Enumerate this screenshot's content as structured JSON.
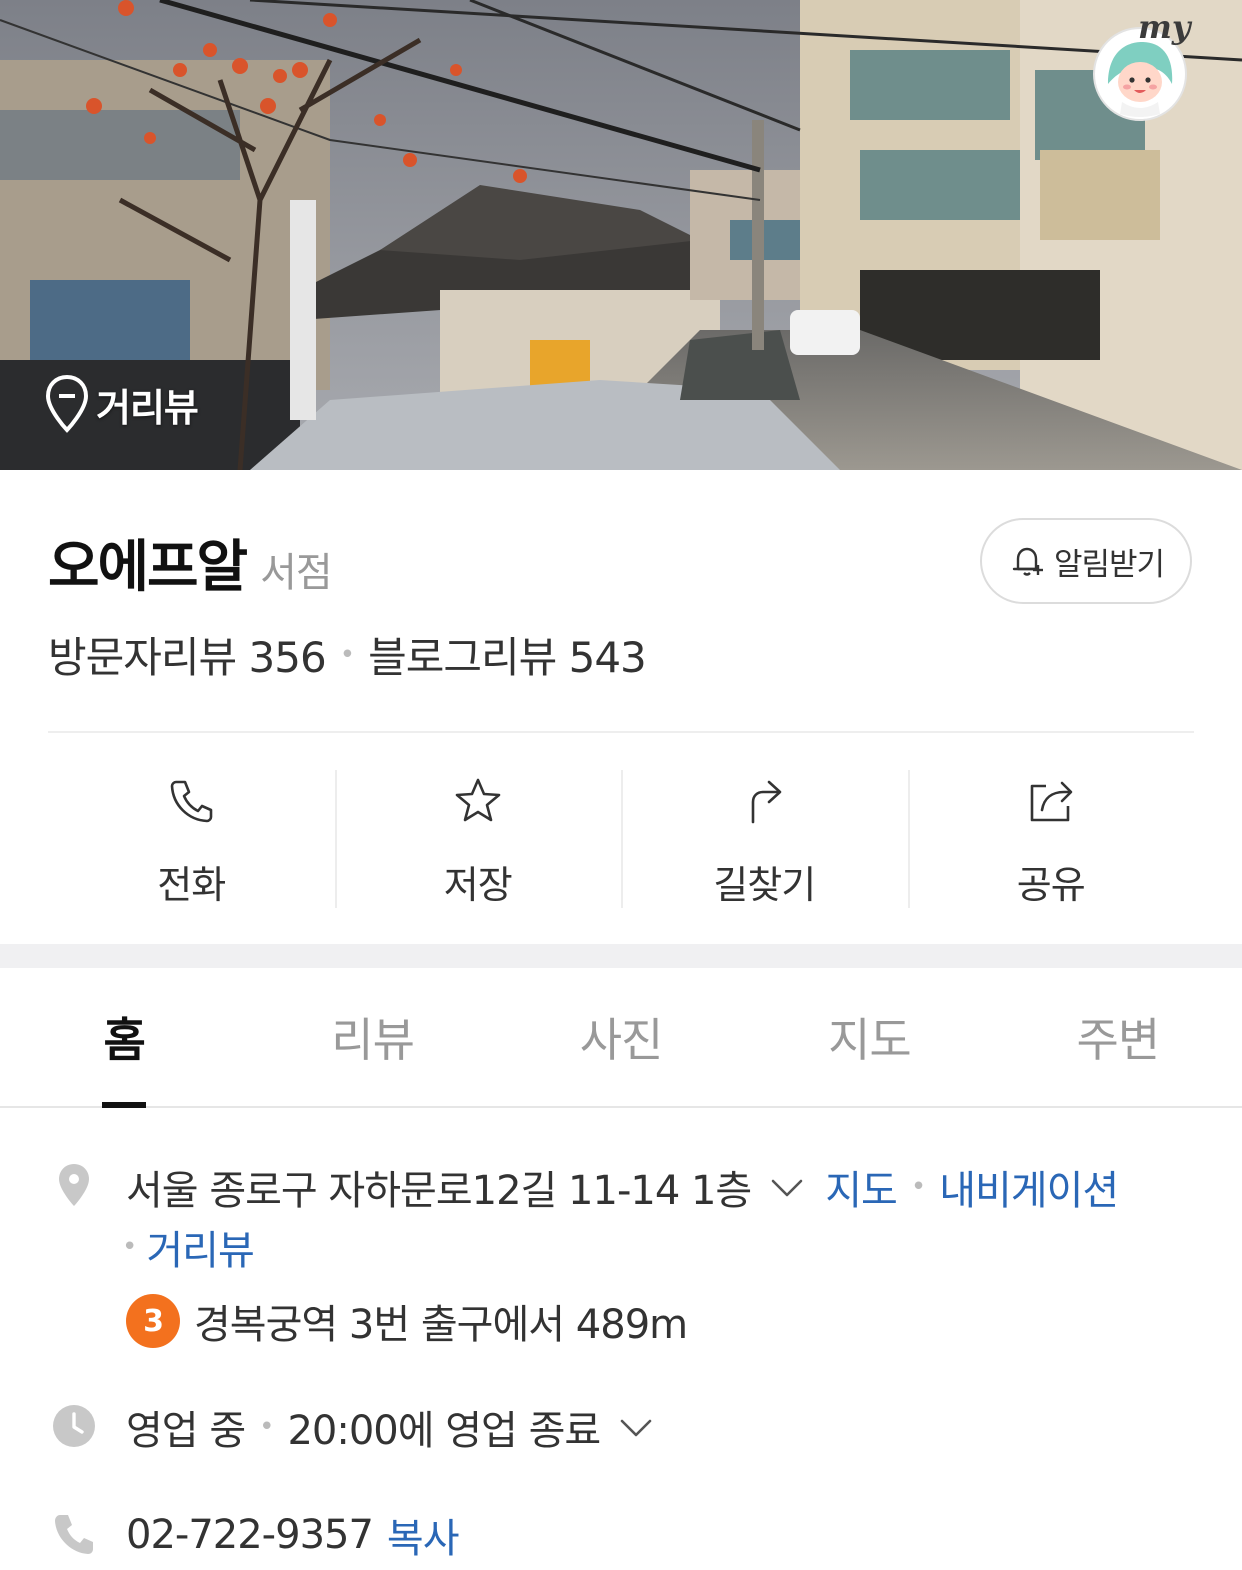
{
  "hero": {
    "streetview_label": "거리뷰",
    "my_label": "my"
  },
  "place": {
    "name": "오에프알",
    "category": "서점",
    "alarm_label": "알림받기"
  },
  "reviews": {
    "visitor": "방문자리뷰 356",
    "blog": "블로그리뷰 543"
  },
  "actions": {
    "call": "전화",
    "save": "저장",
    "directions": "길찾기",
    "share": "공유"
  },
  "tabs": {
    "home": "홈",
    "review": "리뷰",
    "photo": "사진",
    "map": "지도",
    "nearby": "주변"
  },
  "address": {
    "text": "서울 종로구 자하문로12길 11-14 1층",
    "map_link": "지도",
    "navi_link": "내비게이션",
    "streetview_link": "거리뷰",
    "subway_line": "3",
    "subway_text": "경복궁역 3번 출구에서 489m"
  },
  "hours": {
    "status": "영업 중",
    "detail": "20:00에 영업 종료"
  },
  "phone": {
    "number": "02-722-9357",
    "copy_label": "복사"
  },
  "colors": {
    "link": "#2a67b6",
    "subway_line3": "#f3711e"
  }
}
